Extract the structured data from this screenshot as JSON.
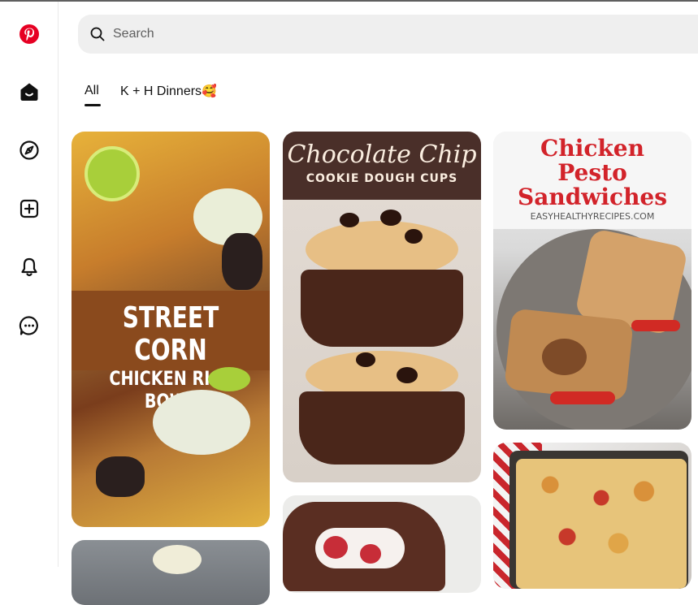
{
  "app": {
    "name": "Pinterest",
    "brand_color": "#e60023"
  },
  "sidebar": {
    "items": [
      {
        "name": "pinterest-logo",
        "icon": "pinterest-logo-icon"
      },
      {
        "name": "home",
        "icon": "home-icon"
      },
      {
        "name": "explore",
        "icon": "compass-icon"
      },
      {
        "name": "create",
        "icon": "plus-square-icon"
      },
      {
        "name": "notifications",
        "icon": "bell-icon"
      },
      {
        "name": "messages",
        "icon": "chat-bubble-icon"
      }
    ]
  },
  "search": {
    "placeholder": "Search",
    "value": ""
  },
  "tabs": [
    {
      "label": "All",
      "active": true
    },
    {
      "label": "K + H Dinners",
      "emoji": "🥰",
      "active": false
    }
  ],
  "pins": [
    {
      "id": "street-corn",
      "lines": [
        "STREET CORN",
        "CHICKEN RICE BOWL"
      ]
    },
    {
      "id": "cookie-dough",
      "title": "Chocolate Chip",
      "subtitle": "COOKIE DOUGH CUPS"
    },
    {
      "id": "pesto-sandwich",
      "title_lines": [
        "Chicken",
        "Pesto",
        "Sandwiches"
      ],
      "source": "EASYHEALTHYRECIPES.COM"
    },
    {
      "id": "cheesy-bites",
      "label": ""
    },
    {
      "id": "strawberry-chocolate",
      "label": ""
    },
    {
      "id": "sauce-dish",
      "label": ""
    }
  ]
}
